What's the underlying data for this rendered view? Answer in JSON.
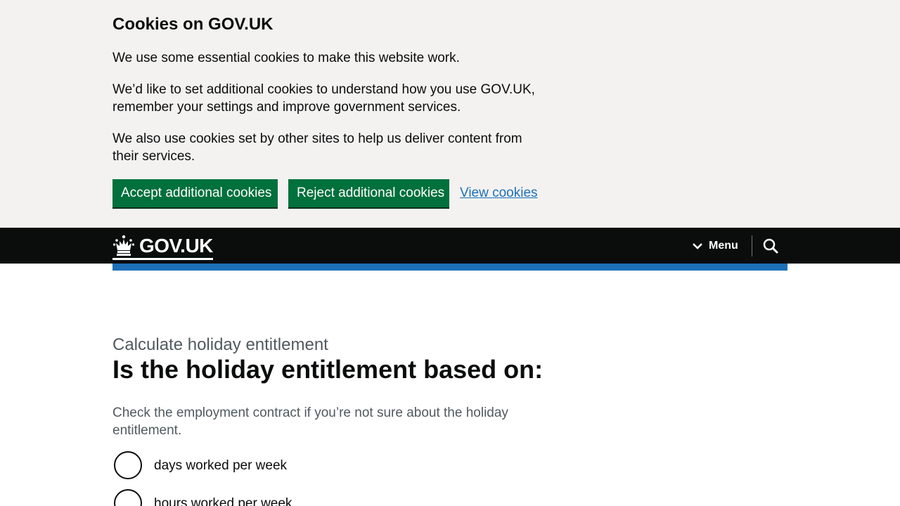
{
  "cookie_banner": {
    "title": "Cookies on GOV.UK",
    "paragraph_1": "We use some essential cookies to make this website work.",
    "paragraph_2": "We’d like to set additional cookies to understand how you use GOV.UK, remember your settings and improve government services.",
    "paragraph_3": "We also use cookies set by other sites to help us deliver content from their services.",
    "accept_label": "Accept additional cookies",
    "reject_label": "Reject additional cookies",
    "view_label": "View cookies",
    "accent_color": "#00703c",
    "link_color": "#1d70b8"
  },
  "header": {
    "logo_text": "GOV.UK",
    "logo_icon": "crown-icon",
    "menu_label": "Menu",
    "menu_icon": "chevron-down-icon",
    "search_icon": "search-icon",
    "background": "#0b0c0c",
    "bar_color": "#1d70b8"
  },
  "main": {
    "caption": "Calculate holiday entitlement",
    "heading": "Is the holiday entitlement based on:",
    "hint": "Check the employment contract if you’re not sure about the holiday entitlement.",
    "options": [
      {
        "label": "days worked per week"
      },
      {
        "label": "hours worked per week"
      }
    ]
  }
}
